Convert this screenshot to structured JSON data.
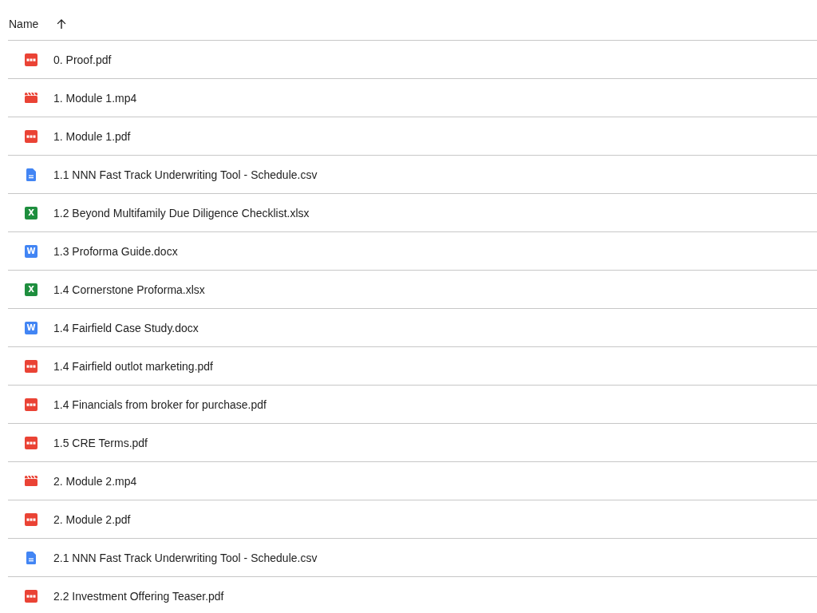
{
  "header": {
    "label": "Name",
    "ascending": true
  },
  "files": [
    {
      "name": "0. Proof.pdf",
      "kind": "pdf"
    },
    {
      "name": "1. Module 1.mp4",
      "kind": "video"
    },
    {
      "name": "1. Module 1.pdf",
      "kind": "pdf"
    },
    {
      "name": "1.1 NNN Fast Track Underwriting Tool - Schedule.csv",
      "kind": "doc"
    },
    {
      "name": "1.2 Beyond Multifamily Due Diligence Checklist.xlsx",
      "kind": "sheet",
      "badge": "X"
    },
    {
      "name": "1.3 Proforma Guide.docx",
      "kind": "word",
      "badge": "W"
    },
    {
      "name": "1.4 Cornerstone Proforma.xlsx",
      "kind": "sheet",
      "badge": "X"
    },
    {
      "name": "1.4 Fairfield Case Study.docx",
      "kind": "word",
      "badge": "W"
    },
    {
      "name": "1.4 Fairfield outlot marketing.pdf",
      "kind": "pdf"
    },
    {
      "name": "1.4 Financials from broker for purchase.pdf",
      "kind": "pdf"
    },
    {
      "name": "1.5 CRE Terms.pdf",
      "kind": "pdf"
    },
    {
      "name": "2. Module 2.mp4",
      "kind": "video"
    },
    {
      "name": "2. Module 2.pdf",
      "kind": "pdf"
    },
    {
      "name": "2.1 NNN Fast Track Underwriting Tool - Schedule.csv",
      "kind": "doc"
    },
    {
      "name": "2.2 Investment Offering Teaser.pdf",
      "kind": "pdf"
    }
  ]
}
